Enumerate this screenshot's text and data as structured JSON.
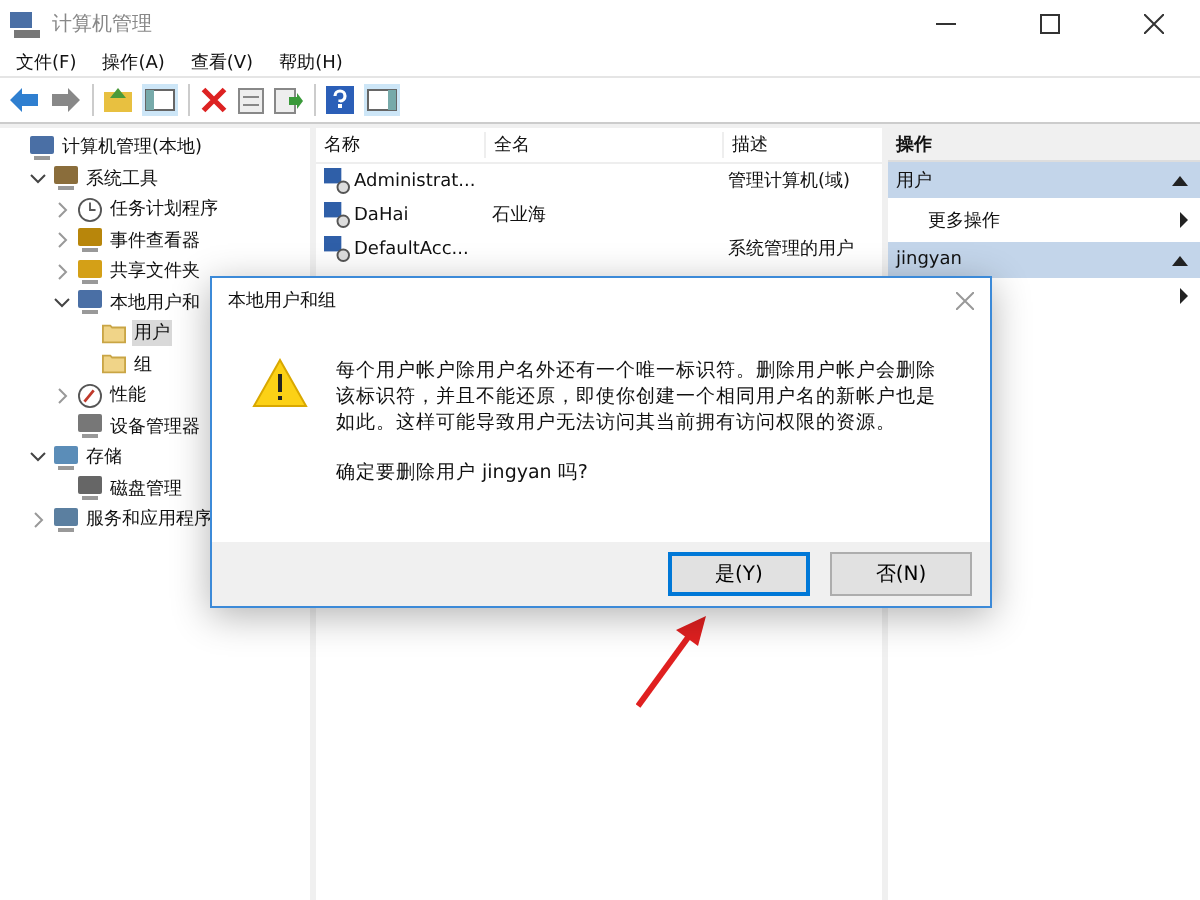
{
  "window": {
    "title": "计算机管理"
  },
  "menu": [
    "文件(F)",
    "操作(A)",
    "查看(V)",
    "帮助(H)"
  ],
  "tree": [
    {
      "label": "计算机管理(本地)",
      "kind": "computer",
      "selected": false,
      "children": [
        {
          "label": "系统工具",
          "kind": "tools",
          "expanded": true,
          "selected": false,
          "children": [
            {
              "label": "任务计划程序",
              "kind": "clock",
              "expanded": false,
              "selected": false
            },
            {
              "label": "事件查看器",
              "kind": "event",
              "expanded": false,
              "selected": false
            },
            {
              "label": "共享文件夹",
              "kind": "share",
              "expanded": false,
              "selected": false
            },
            {
              "label": "本地用户和",
              "kind": "users",
              "expanded": true,
              "selected": false,
              "children": [
                {
                  "label": "用户",
                  "kind": "folder",
                  "selected": true
                },
                {
                  "label": "组",
                  "kind": "folder",
                  "selected": false
                }
              ]
            },
            {
              "label": "性能",
              "kind": "perf",
              "expanded": false,
              "selected": false
            },
            {
              "label": "设备管理器",
              "kind": "device",
              "selected": false
            }
          ]
        },
        {
          "label": "存储",
          "kind": "storage",
          "expanded": true,
          "selected": false,
          "children": [
            {
              "label": "磁盘管理",
              "kind": "disk",
              "selected": false
            }
          ]
        },
        {
          "label": "服务和应用程序",
          "kind": "services",
          "expanded": false,
          "selected": false
        }
      ]
    }
  ],
  "table": {
    "columns": [
      "名称",
      "全名",
      "描述"
    ],
    "rows": [
      {
        "name": "Administrat...",
        "full_name": "",
        "description": "管理计算机(域)"
      },
      {
        "name": "DaHai",
        "full_name": "石业海",
        "description": ""
      },
      {
        "name": "DefaultAcc...",
        "full_name": "",
        "description": "系统管理的用户"
      }
    ]
  },
  "actions": {
    "title": "操作",
    "sections": [
      {
        "header": "用户",
        "items": [
          "更多操作"
        ]
      },
      {
        "header": "jingyan"
      }
    ]
  },
  "dialog": {
    "title": "本地用户和组",
    "message": "每个用户帐户除用户名外还有一个唯一标识符。删除用户帐户会删除该标识符，并且不能还原，即使你创建一个相同用户名的新帐户也是如此。这样可能导致用户无法访问其当前拥有访问权限的资源。",
    "question": "确定要删除用户 jingyan 吗?",
    "buttons": [
      {
        "label": "是(Y)",
        "selected": true
      },
      {
        "label": "否(N)",
        "selected": false
      }
    ]
  }
}
